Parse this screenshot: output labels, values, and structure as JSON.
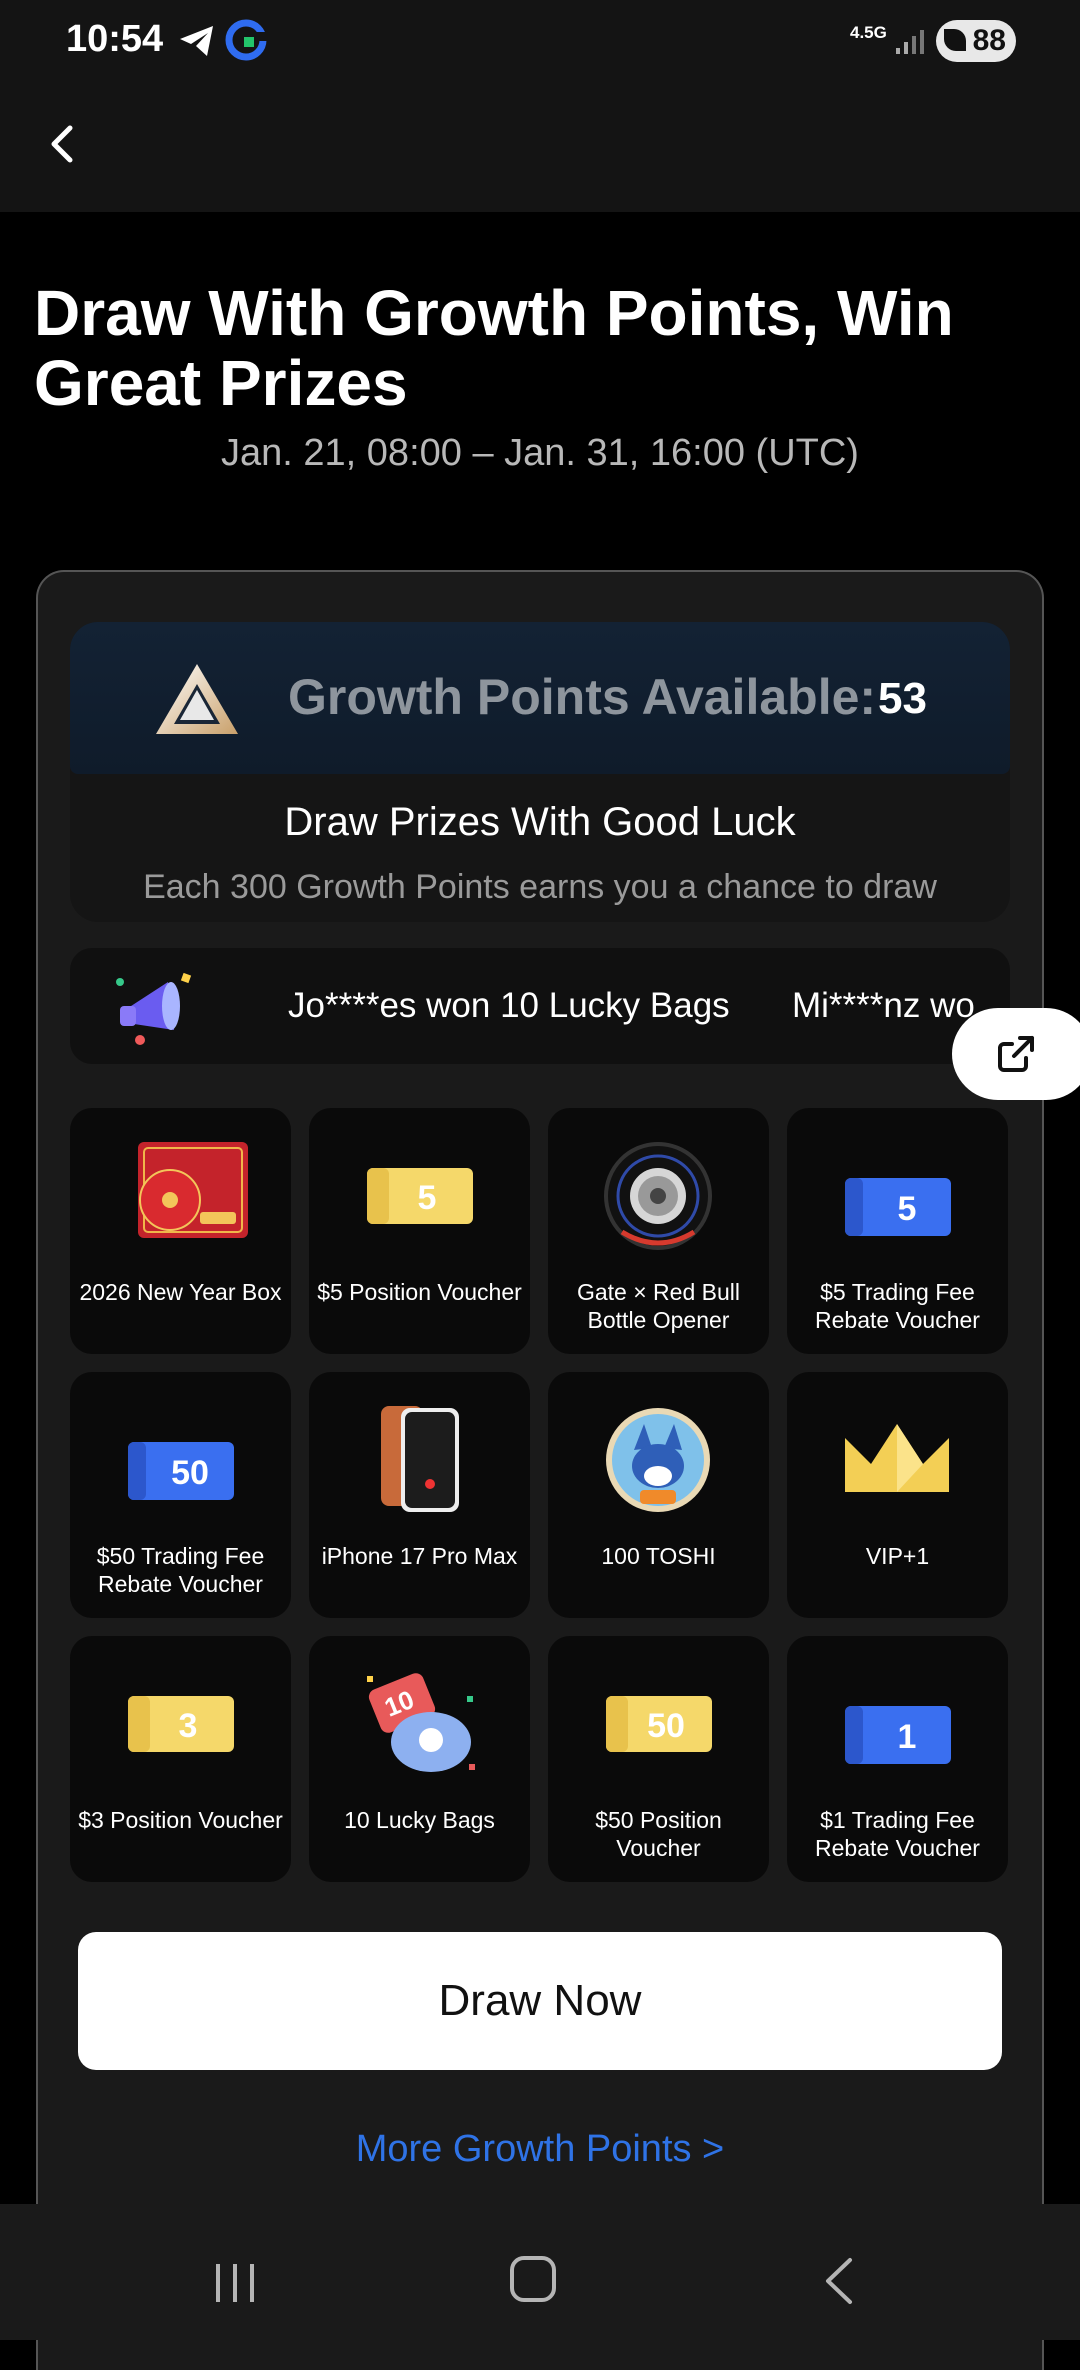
{
  "status_bar": {
    "time": "10:54",
    "network": "4.5G",
    "battery": "88"
  },
  "header": {
    "back_label": "Back"
  },
  "page": {
    "title": "Draw With Growth Points, Win Great Prizes",
    "dates": "Jan. 21, 08:00 – Jan. 31, 16:00 (UTC)"
  },
  "points": {
    "label": "Growth Points Available:",
    "value": "53",
    "draw_heading": "Draw Prizes With Good Luck",
    "draw_sub": "Each 300 Growth Points earns you a chance to draw"
  },
  "ticker": {
    "items": [
      "Jo****es won 10 Lucky Bags",
      "Mi****nz wo"
    ]
  },
  "prizes": [
    {
      "label": "2026 New Year Box",
      "icon": "gift-box-icon"
    },
    {
      "label": "$5 Position Voucher",
      "icon": "gold-ticket-icon",
      "badge": "5"
    },
    {
      "label": "Gate × Red Bull Bottle Opener",
      "icon": "tire-icon"
    },
    {
      "label": "$5 Trading Fee Rebate Voucher",
      "icon": "blue-ticket-icon",
      "badge": "5"
    },
    {
      "label": "$50 Trading Fee Rebate Voucher",
      "icon": "blue-ticket-icon",
      "badge": "50"
    },
    {
      "label": "iPhone 17 Pro Max",
      "icon": "phone-icon"
    },
    {
      "label": "100 TOSHI",
      "icon": "toshi-icon"
    },
    {
      "label": "VIP+1",
      "icon": "crown-icon"
    },
    {
      "label": "$3 Position Voucher",
      "icon": "gold-ticket-icon",
      "badge": "3"
    },
    {
      "label": "10 Lucky Bags",
      "icon": "lucky-bag-icon",
      "badge": "10"
    },
    {
      "label": "$50 Position Voucher",
      "icon": "gold-ticket-icon",
      "badge": "50"
    },
    {
      "label": "$1 Trading Fee Rebate Voucher",
      "icon": "blue-ticket-icon",
      "badge": "1"
    }
  ],
  "actions": {
    "draw_button": "Draw Now",
    "more_link": "More Growth Points  >"
  },
  "colors": {
    "accent_blue": "#2f73e6",
    "gold": "#f5d86a",
    "voucher_blue": "#3a6ff0",
    "background": "#000000"
  }
}
